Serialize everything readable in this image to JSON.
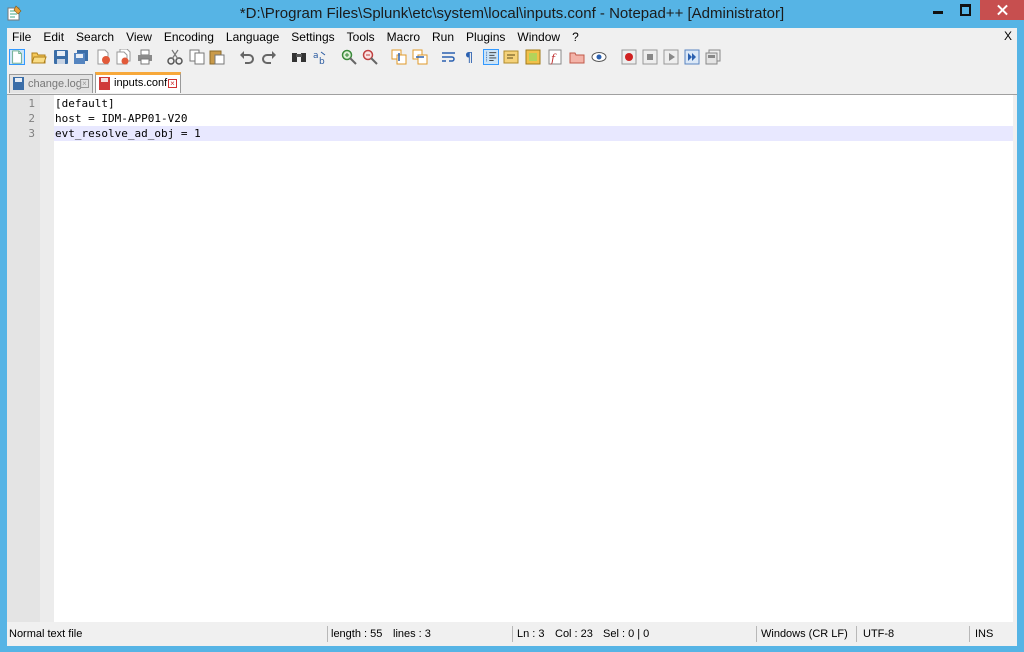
{
  "window": {
    "title": "*D:\\Program Files\\Splunk\\etc\\system\\local\\inputs.conf - Notepad++ [Administrator]",
    "icon": "notepad-plus-plus-icon"
  },
  "menu": {
    "items": [
      "File",
      "Edit",
      "Search",
      "View",
      "Encoding",
      "Language",
      "Settings",
      "Tools",
      "Macro",
      "Run",
      "Plugins",
      "Window",
      "?"
    ],
    "close_label": "X"
  },
  "toolbar": {
    "icons": [
      "new-file-icon",
      "open-file-icon",
      "save-icon",
      "save-all-icon",
      "close-icon",
      "close-all-icon",
      "print-icon",
      "cut-icon",
      "copy-icon",
      "paste-icon",
      "undo-icon",
      "redo-icon",
      "find-icon",
      "replace-icon",
      "zoom-in-icon",
      "zoom-out-icon",
      "sync-vertical-icon",
      "sync-horizontal-icon",
      "word-wrap-icon",
      "show-all-chars-icon",
      "indent-guide-icon",
      "user-language-icon",
      "doc-map-icon",
      "function-list-icon",
      "folder-workspace-icon",
      "monitoring-icon",
      "record-macro-icon",
      "stop-macro-icon",
      "play-macro-icon",
      "run-macro-multiple-icon",
      "save-macro-icon"
    ]
  },
  "tabs": [
    {
      "label": "change.log",
      "active": false
    },
    {
      "label": "inputs.conf",
      "active": true
    }
  ],
  "editor": {
    "lines": [
      {
        "number": "1",
        "text": "[default]"
      },
      {
        "number": "2",
        "text": "host = IDM-APP01-V20"
      },
      {
        "number": "3",
        "text": "evt_resolve_ad_obj = 1"
      }
    ],
    "current_line": 3
  },
  "status": {
    "filetype": "Normal text file",
    "length": "length : 55",
    "lines": "lines : 3",
    "ln": "Ln : 3",
    "col": "Col : 23",
    "sel": "Sel : 0 | 0",
    "eol": "Windows (CR LF)",
    "encoding": "UTF-8",
    "mode": "INS"
  },
  "colors": {
    "frame": "#56b4e5",
    "close_button": "#c74f4f",
    "current_line": "#e8e8ff",
    "active_tab_accent": "#f7a83a"
  }
}
